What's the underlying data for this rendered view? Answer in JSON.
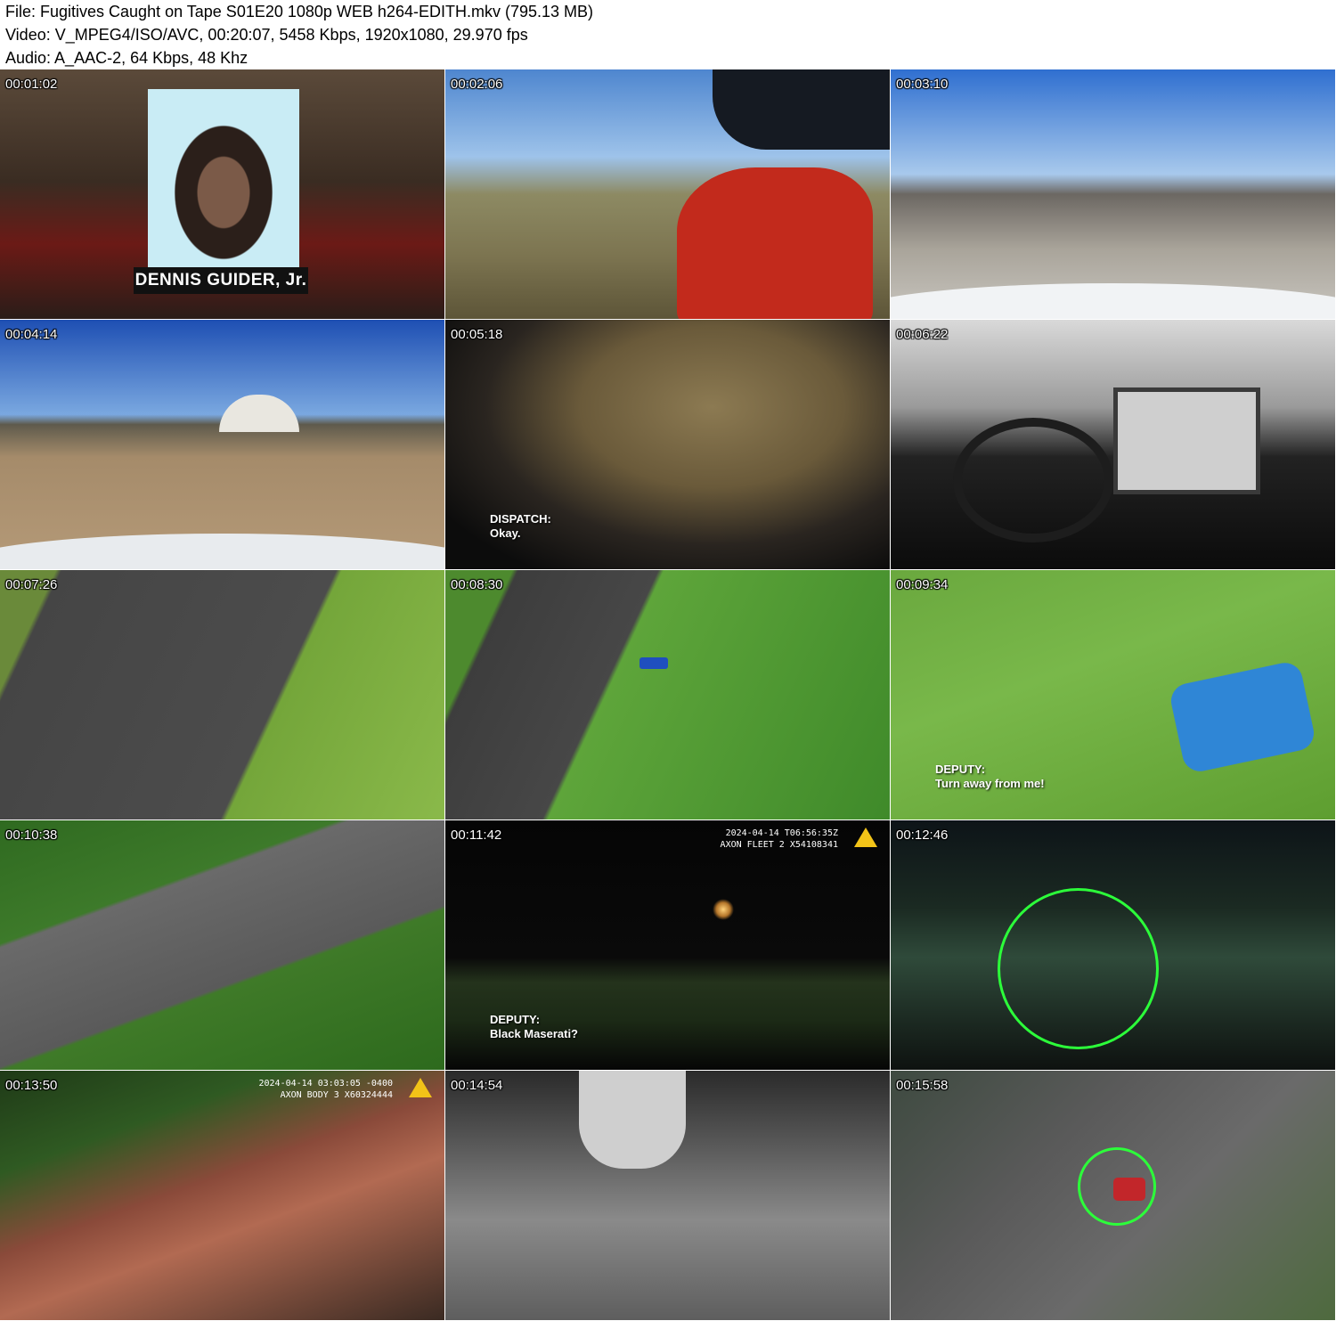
{
  "header": {
    "file_line": "File: Fugitives Caught on Tape S01E20 1080p WEB h264-EDITH.mkv (795.13 MB)",
    "video_line": "Video: V_MPEG4/ISO/AVC, 00:20:07, 5458 Kbps, 1920x1080, 29.970 fps",
    "audio_line": "Audio: A_AAC-2, 64 Kbps, 48 Khz"
  },
  "thumbnails": [
    {
      "time": "00:01:02",
      "nameplate": "DENNIS GUIDER, Jr."
    },
    {
      "time": "00:02:06"
    },
    {
      "time": "00:03:10"
    },
    {
      "time": "00:04:14"
    },
    {
      "time": "00:05:18",
      "caption_speaker": "DISPATCH:",
      "caption_text": "Okay."
    },
    {
      "time": "00:06:22"
    },
    {
      "time": "00:07:26"
    },
    {
      "time": "00:08:30"
    },
    {
      "time": "00:09:34",
      "caption_speaker": "DEPUTY:",
      "caption_text": "Turn away from me!"
    },
    {
      "time": "00:10:38"
    },
    {
      "time": "00:11:42",
      "stamp_line1": "2024-04-14 T06:56:35Z",
      "stamp_line2": "AXON FLEET 2 X54108341",
      "caption_speaker": "DEPUTY:",
      "caption_text": "Black Maserati?"
    },
    {
      "time": "00:12:46"
    },
    {
      "time": "00:13:50",
      "stamp_line1": "2024-04-14 03:03:05 -0400",
      "stamp_line2": "AXON BODY 3 X60324444"
    },
    {
      "time": "00:14:54"
    },
    {
      "time": "00:15:58"
    }
  ],
  "colors": {
    "hud_green": "#3dff3d",
    "axon_yellow": "#f2c318"
  }
}
